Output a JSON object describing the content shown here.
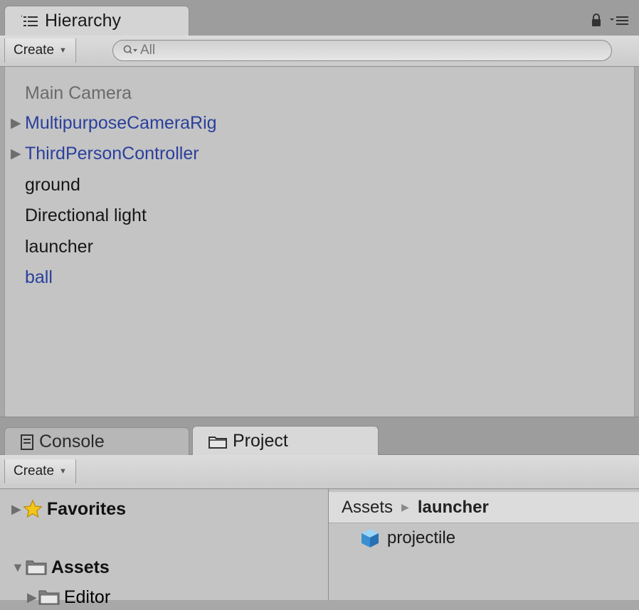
{
  "hierarchy": {
    "tab_label": "Hierarchy",
    "create_label": "Create",
    "search_placeholder": "All",
    "items": [
      {
        "label": "Main Camera",
        "color": "gray",
        "expandable": false
      },
      {
        "label": "MultipurposeCameraRig",
        "color": "blue",
        "expandable": true
      },
      {
        "label": "ThirdPersonController",
        "color": "blue",
        "expandable": true
      },
      {
        "label": "ground",
        "color": "black",
        "expandable": false
      },
      {
        "label": "Directional light",
        "color": "black",
        "expandable": false
      },
      {
        "label": "launcher",
        "color": "black",
        "expandable": false
      },
      {
        "label": "ball",
        "color": "blue",
        "expandable": false
      }
    ]
  },
  "tabs": {
    "console_label": "Console",
    "project_label": "Project"
  },
  "project": {
    "create_label": "Create",
    "tree": {
      "favorites": "Favorites",
      "assets": "Assets",
      "editor": "Editor"
    },
    "breadcrumb": {
      "root": "Assets",
      "current": "launcher"
    },
    "asset_item": "projectile"
  },
  "colors": {
    "prefab_blue": "#2a3f9c",
    "disabled_gray": "#6b6b6b",
    "panel_bg": "#c4c4c4"
  },
  "icons": {
    "hierarchy": "list-icon",
    "lock": "lock-icon",
    "menu": "panel-menu-icon",
    "console": "console-icon",
    "project": "folder-icon",
    "favorites": "star-icon",
    "folder": "folder-icon",
    "prefab": "cube-icon",
    "search": "search-icon"
  }
}
